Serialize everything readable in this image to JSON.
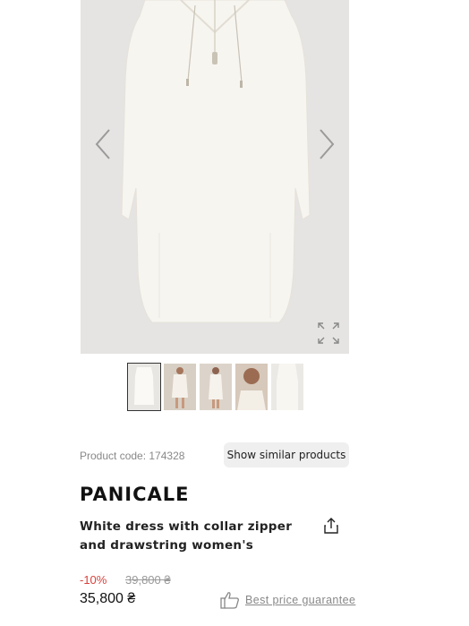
{
  "product": {
    "code_label": "Product code: 174328",
    "similar_button": "Show similar products",
    "brand": "PANICALE",
    "title": "White dress with collar zipper and drawstring women's",
    "discount": "-10%",
    "old_price": "39,800 ₴",
    "price": "35,800 ₴",
    "guarantee_label": "Best price guarantee"
  },
  "gallery": {
    "thumbnails": [
      "thumb-1",
      "thumb-2",
      "thumb-3",
      "thumb-4",
      "thumb-5"
    ],
    "active_index": 0
  },
  "icons": {
    "prev": "chevron-left-icon",
    "next": "chevron-right-icon",
    "expand": "expand-icon",
    "share": "share-icon",
    "guarantee": "thumbs-up-icon"
  },
  "colors": {
    "discount": "#d9413b",
    "gallery_bg": "#e5e4e2"
  }
}
